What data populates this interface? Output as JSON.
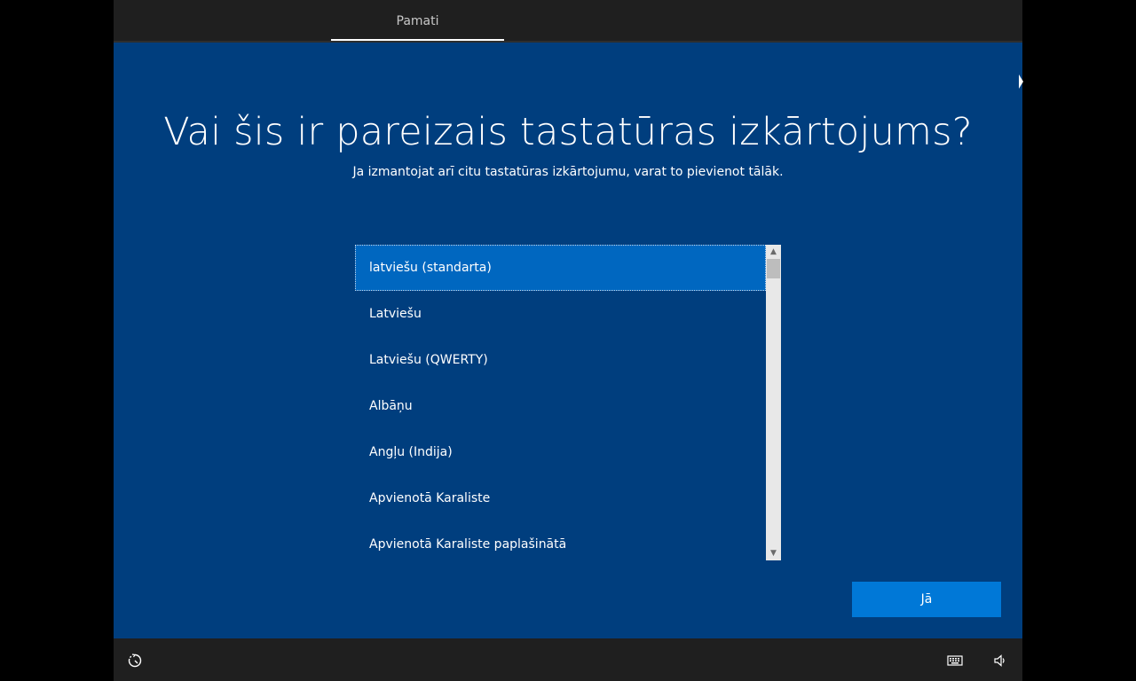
{
  "window": {
    "tabs": [
      {
        "label": "Pamati",
        "active": true
      }
    ]
  },
  "main": {
    "title": "Vai šis ir pareizais tastatūras izkārtojums?",
    "subtitle": "Ja izmantojat arī citu tastatūras izkārtojumu, varat to pievienot tālāk."
  },
  "layout_list": {
    "selected_index": 0,
    "items": [
      "latviešu (standarta)",
      "Latviešu",
      "Latviešu (QWERTY)",
      "Albāņu",
      "Angļu (Indija)",
      "Apvienotā Karaliste",
      "Apvienotā Karaliste paplašinātā"
    ]
  },
  "buttons": {
    "yes_label": "Jā"
  },
  "taskbar": {
    "left_icon": "accessibility-icon",
    "right_icons": [
      "keyboard-icon",
      "volume-icon"
    ]
  },
  "colors": {
    "background": "#003e7e",
    "bar": "#1f1f1f",
    "selection": "#0067c0",
    "button": "#0078d7"
  }
}
